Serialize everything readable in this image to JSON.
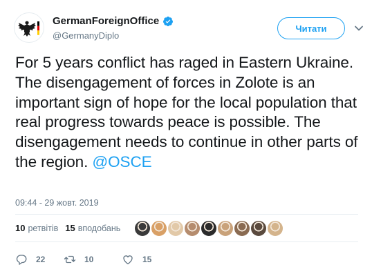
{
  "account": {
    "display_name": "GermanForeignOffice",
    "handle": "@GermanyDiplo",
    "verified": true
  },
  "follow_button": {
    "label": "Читати"
  },
  "tweet": {
    "text": "For 5 years conflict has raged in Eastern Ukraine. The disengagement of forces in Zolote is an important sign of hope for the local population that real progress towards peace is possible. The disengagement needs to continue in other parts of the region.",
    "mention": "@OSCE",
    "timestamp": "09:44 - 29 жовт. 2019"
  },
  "stats": {
    "retweets_count": "10",
    "retweets_label": "ретвітів",
    "likes_count": "15",
    "likes_label": "вподобань"
  },
  "likers": [
    {
      "color": "#3a3a3a"
    },
    {
      "color": "#d9a066"
    },
    {
      "color": "#e2c9a8"
    },
    {
      "color": "#b58c6e"
    },
    {
      "color": "#2b2b2b"
    },
    {
      "color": "#c9a27a"
    },
    {
      "color": "#8a6b52"
    },
    {
      "color": "#5a4a3e"
    },
    {
      "color": "#d4b48c"
    }
  ],
  "actions": {
    "reply_count": "22",
    "retweet_count": "10",
    "like_count": "15"
  },
  "colors": {
    "accent": "#1da1f2",
    "retweet": "#17bf63",
    "text": "#14171a",
    "muted": "#657786"
  },
  "icons": {
    "avatar": "german-eagle-flag-logo",
    "verified": "verified-badge-icon",
    "caret": "chevron-down-icon",
    "reply": "reply-icon",
    "retweet": "retweet-icon",
    "like": "heart-icon"
  }
}
